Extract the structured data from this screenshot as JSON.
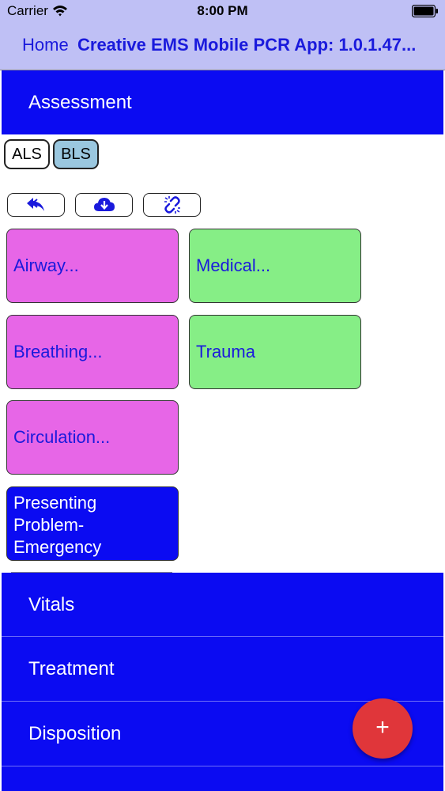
{
  "status_bar": {
    "carrier": "Carrier",
    "time": "8:00 PM",
    "wifi_icon": "wifi-icon",
    "battery_icon": "battery-icon"
  },
  "nav": {
    "home": "Home",
    "title": "Creative EMS Mobile PCR App: 1.0.1.47..."
  },
  "sections": {
    "assessment": "Assessment",
    "vitals": "Vitals",
    "treatment": "Treatment",
    "disposition": "Disposition"
  },
  "toggles": {
    "als": "ALS",
    "bls": "BLS",
    "selected": "BLS"
  },
  "toolbar": {
    "icons": [
      "undo-icon",
      "cloud-download-icon",
      "unlink-icon"
    ]
  },
  "tiles": {
    "airway": "Airway...",
    "medical": "Medical...",
    "breathing": "Breathing...",
    "trauma": "Trauma",
    "circulation": "Circulation...",
    "presenting": "Presenting Problem-Emergency",
    "presenting_lines": [
      "Presenting",
      "Problem-",
      "Emergency"
    ]
  },
  "fab": {
    "label": "+",
    "icon": "plus-icon"
  },
  "colors": {
    "nav_bg": "#bfc0f5",
    "nav_text": "#1a1adc",
    "section_bg": "#0b0bf2",
    "tile_pink": "#e766e7",
    "tile_green": "#86ee86",
    "toggle_selected": "#9ac7df",
    "fab": "#e0363a"
  }
}
